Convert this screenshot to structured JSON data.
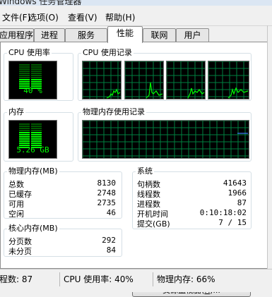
{
  "window": {
    "title": "Windows 任务管理器"
  },
  "menu": [
    {
      "label": "文件(F)",
      "text": "文件(F)"
    },
    {
      "text": "选项(O)"
    },
    {
      "text": "查看(V)"
    },
    {
      "text": "帮助(H)"
    }
  ],
  "tabs": [
    "应用程序",
    "进程",
    "服务",
    "性能",
    "联网",
    "用户"
  ],
  "active_tab": "性能",
  "cpu_usage": {
    "title": "CPU 使用率",
    "value_text": "40 %",
    "percent": 40
  },
  "cpu_history": {
    "title": "CPU 使用记录",
    "cores": 4
  },
  "memory_usage": {
    "title": "内存",
    "value_text": "5.26 GB",
    "percent": 66
  },
  "memory_history": {
    "title": "物理内存使用记录",
    "percent": 66
  },
  "physical_memory": {
    "title": "物理内存(MB)",
    "rows": [
      {
        "label": "总数",
        "value": "8130"
      },
      {
        "label": "已缓存",
        "value": "2748"
      },
      {
        "label": "可用",
        "value": "2735"
      },
      {
        "label": "空闲",
        "value": "46"
      }
    ]
  },
  "kernel_memory": {
    "title": "核心内存(MB)",
    "rows": [
      {
        "label": "分页数",
        "value": "292"
      },
      {
        "label": "未分页",
        "value": "84"
      }
    ]
  },
  "system": {
    "title": "系统",
    "rows": [
      {
        "label": "句柄数",
        "value": "41643"
      },
      {
        "label": "线程数",
        "value": "1966"
      },
      {
        "label": "进程数",
        "value": "87"
      },
      {
        "label": "开机时间",
        "value": "0:10:18:02"
      },
      {
        "label": "提交(GB)",
        "value": "7 / 15"
      }
    ]
  },
  "resource_monitor_button": {
    "prefix": "资源监视器(",
    "hotkey": "R",
    "suffix": ")..."
  },
  "statusbar": {
    "processes": "程数: 87",
    "cpu": "CPU 使用率: 40%",
    "memory": "物理内存: 66%"
  },
  "colors": {
    "graph_bg": "#000000",
    "graph_green": "#00ff00",
    "grid_green": "#008040",
    "memory_line": "#3f7fff"
  }
}
